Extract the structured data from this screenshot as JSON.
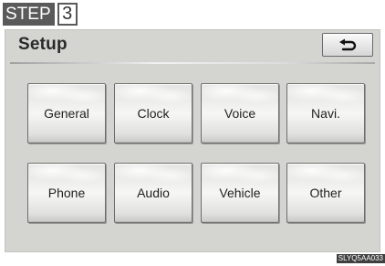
{
  "step": {
    "word": "STEP",
    "number": "3"
  },
  "screen": {
    "title": "Setup",
    "back_icon": "return-arrow-icon"
  },
  "buttons": [
    {
      "label": "General"
    },
    {
      "label": "Clock"
    },
    {
      "label": "Voice"
    },
    {
      "label": "Navi."
    },
    {
      "label": "Phone"
    },
    {
      "label": "Audio"
    },
    {
      "label": "Vehicle"
    },
    {
      "label": "Other"
    }
  ],
  "figure_code": "SLYQ5AA033"
}
